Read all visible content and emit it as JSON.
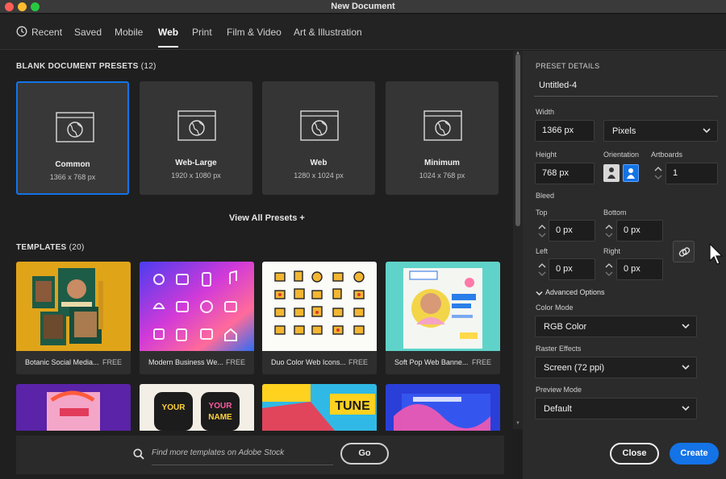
{
  "window": {
    "title": "New Document"
  },
  "tabs": [
    {
      "label": "Recent"
    },
    {
      "label": "Saved"
    },
    {
      "label": "Mobile"
    },
    {
      "label": "Web",
      "active": true
    },
    {
      "label": "Print"
    },
    {
      "label": "Film & Video"
    },
    {
      "label": "Art & Illustration"
    }
  ],
  "presets": {
    "heading": "BLANK DOCUMENT PRESETS",
    "count": "(12)",
    "items": [
      {
        "name": "Common",
        "dims": "1366 x 768 px",
        "selected": true,
        "icon": "web-document-icon"
      },
      {
        "name": "Web-Large",
        "dims": "1920 x 1080 px",
        "icon": "web-document-icon"
      },
      {
        "name": "Web",
        "dims": "1280 x 1024 px",
        "icon": "web-document-icon"
      },
      {
        "name": "Minimum",
        "dims": "1024 x 768 px",
        "icon": "web-document-icon"
      }
    ],
    "view_all": "View All Presets +"
  },
  "templates": {
    "heading": "TEMPLATES",
    "count": "(20)",
    "items": [
      {
        "name": "Botanic Social Media...",
        "badge": "FREE"
      },
      {
        "name": "Modern Business We...",
        "badge": "FREE"
      },
      {
        "name": "Duo Color Web Icons...",
        "badge": "FREE"
      },
      {
        "name": "Soft Pop Web Banne...",
        "badge": "FREE"
      }
    ]
  },
  "stock": {
    "placeholder": "Find more templates on Adobe Stock",
    "go_label": "Go"
  },
  "details": {
    "heading": "PRESET DETAILS",
    "name": "Untitled-4",
    "width_label": "Width",
    "width_value": "1366 px",
    "units": "Pixels",
    "height_label": "Height",
    "height_value": "768 px",
    "orientation_label": "Orientation",
    "artboards_label": "Artboards",
    "artboards_value": "1",
    "bleed_label": "Bleed",
    "top_label": "Top",
    "top_value": "0 px",
    "bottom_label": "Bottom",
    "bottom_value": "0 px",
    "left_label": "Left",
    "left_value": "0 px",
    "right_label": "Right",
    "right_value": "0 px",
    "advanced_label": "Advanced Options",
    "color_mode_label": "Color Mode",
    "color_mode_value": "RGB Color",
    "raster_label": "Raster Effects",
    "raster_value": "Screen (72 ppi)",
    "preview_label": "Preview Mode",
    "preview_value": "Default"
  },
  "actions": {
    "close_label": "Close",
    "create_label": "Create"
  },
  "colors": {
    "accent": "#1473e6",
    "background": "#1f1f1f",
    "panel": "#2b2b2b"
  }
}
